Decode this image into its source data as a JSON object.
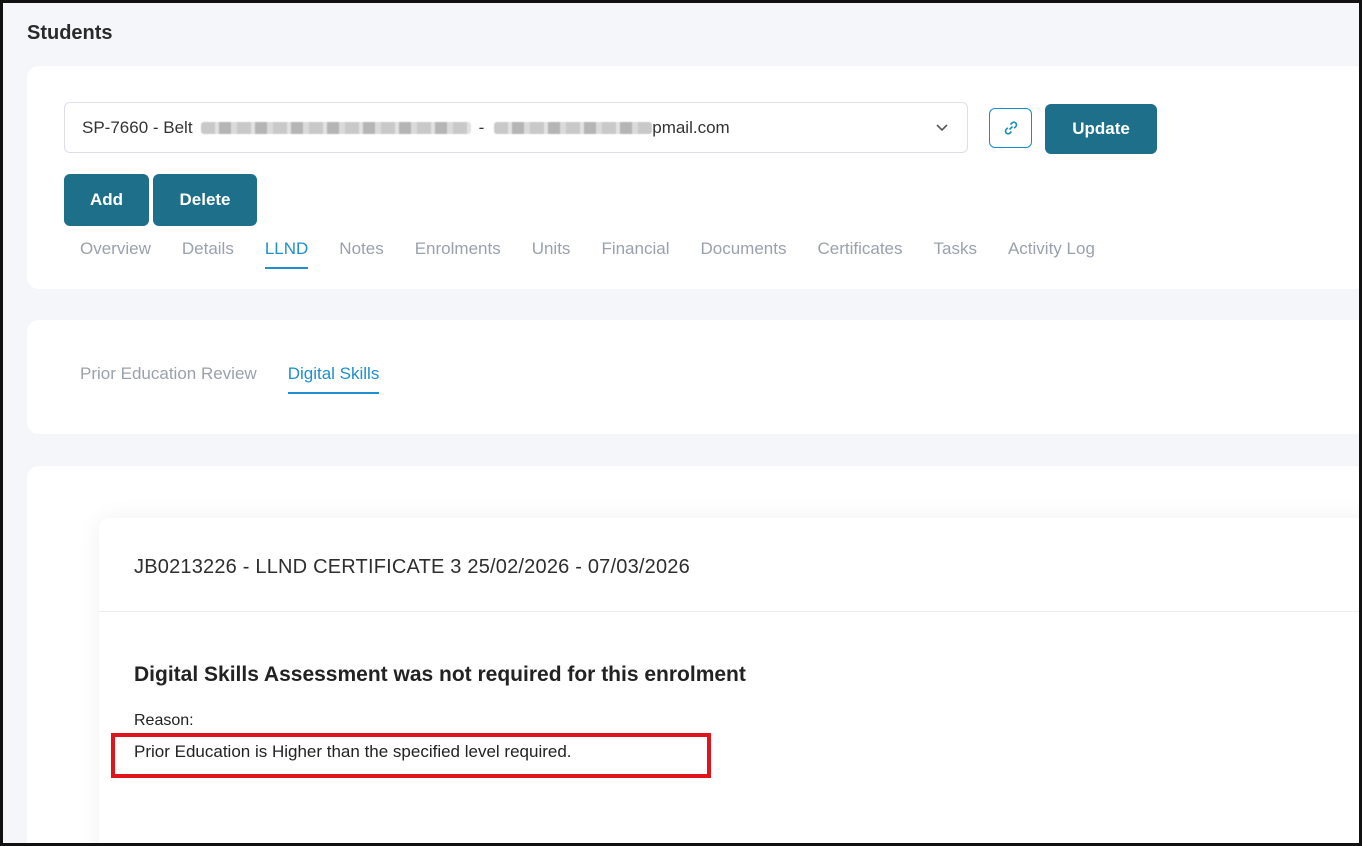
{
  "page": {
    "title": "Students"
  },
  "student_select": {
    "prefix": "SP-7660 - Belt",
    "separator": "-",
    "suffix": "pmail.com"
  },
  "toolbar": {
    "update_label": "Update",
    "add_label": "Add",
    "delete_label": "Delete"
  },
  "tabs": [
    {
      "label": "Overview"
    },
    {
      "label": "Details"
    },
    {
      "label": "LLND",
      "active": true
    },
    {
      "label": "Notes"
    },
    {
      "label": "Enrolments"
    },
    {
      "label": "Units"
    },
    {
      "label": "Financial"
    },
    {
      "label": "Documents"
    },
    {
      "label": "Certificates"
    },
    {
      "label": "Tasks"
    },
    {
      "label": "Activity Log"
    }
  ],
  "subtabs": [
    {
      "label": "Prior Education Review"
    },
    {
      "label": "Digital Skills",
      "active": true
    }
  ],
  "enrolment": {
    "title": "JB0213226 - LLND CERTIFICATE 3 25/02/2026 - 07/03/2026",
    "heading": "Digital Skills Assessment was not required for this enrolment",
    "reason_label": "Reason:",
    "reason_text": "Prior Education is Higher than the specified level required."
  },
  "colors": {
    "primary_button": "#1d6f8a",
    "active_tab": "#1e8fcf",
    "highlight": "#e0141c"
  },
  "icons": [
    "chevron-down-icon",
    "link-icon"
  ]
}
